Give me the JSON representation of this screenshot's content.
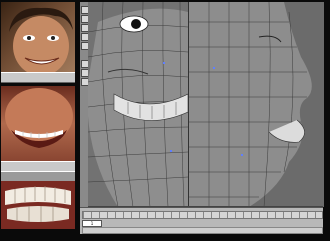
{
  "title": "",
  "reference_photos": [
    {
      "name": "smiling-face-photo"
    },
    {
      "name": "teeth-photo"
    },
    {
      "name": "mouth-closeup-photo"
    }
  ],
  "maya": {
    "frame_value": "1",
    "viewports": [
      "front",
      "side"
    ],
    "outliner_left": "",
    "outliner_right": ""
  },
  "colors": {
    "background": "#0a0a0a",
    "viewport": "#6e6e6e",
    "outliner_text": "#5cff5c",
    "ui_grey": "#b8b8b8"
  }
}
